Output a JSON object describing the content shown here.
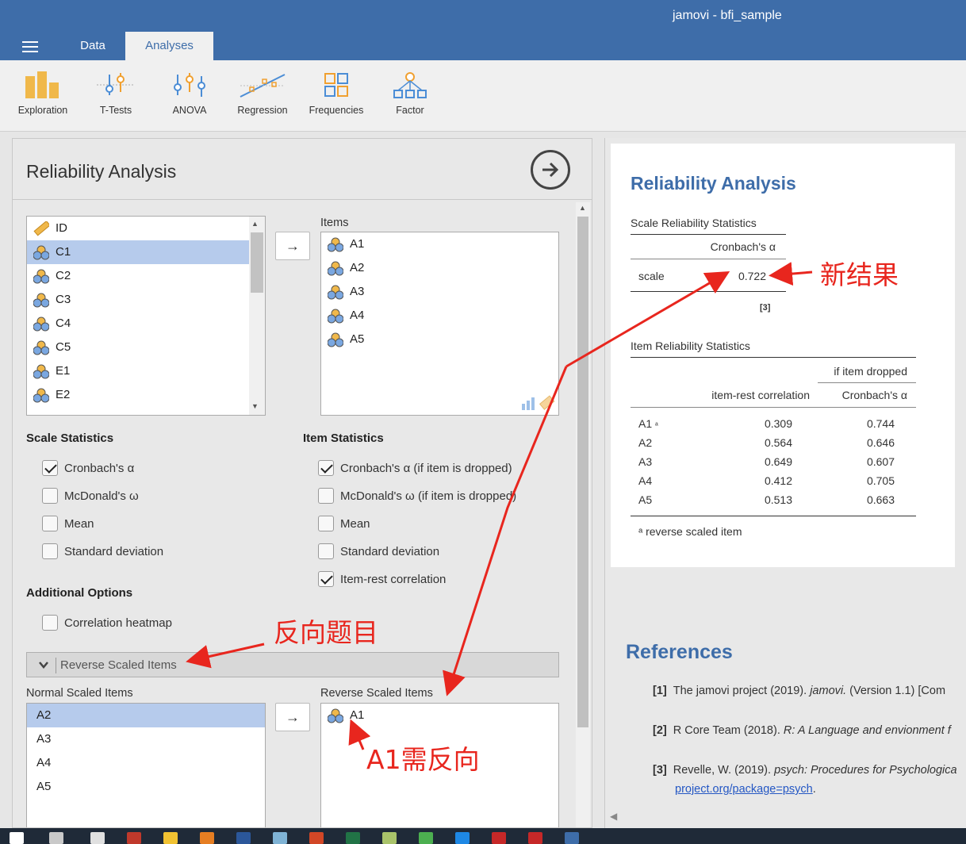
{
  "window": {
    "title": "jamovi - bfi_sample"
  },
  "tabs": [
    {
      "label": "Data"
    },
    {
      "label": "Analyses"
    }
  ],
  "ribbon": [
    {
      "label": "Exploration",
      "icon": "exploration-icon"
    },
    {
      "label": "T-Tests",
      "icon": "t-tests-icon"
    },
    {
      "label": "ANOVA",
      "icon": "anova-icon"
    },
    {
      "label": "Regression",
      "icon": "regression-icon"
    },
    {
      "label": "Frequencies",
      "icon": "frequencies-icon"
    },
    {
      "label": "Factor",
      "icon": "factor-icon"
    }
  ],
  "options": {
    "title": "Reliability Analysis",
    "variables": [
      "ID",
      "C1",
      "C2",
      "C3",
      "C4",
      "C5",
      "E1",
      "E2"
    ],
    "items_label": "Items",
    "items": [
      "A1",
      "A2",
      "A3",
      "A4",
      "A5"
    ],
    "scale_statistics": {
      "heading": "Scale Statistics",
      "options": [
        {
          "label": "Cronbach's α",
          "checked": true
        },
        {
          "label": "McDonald's ω",
          "checked": false
        },
        {
          "label": "Mean",
          "checked": false
        },
        {
          "label": "Standard deviation",
          "checked": false
        }
      ]
    },
    "item_statistics": {
      "heading": "Item Statistics",
      "options": [
        {
          "label": "Cronbach's α (if item is dropped)",
          "checked": true
        },
        {
          "label": "McDonald's ω (if item is dropped)",
          "checked": false
        },
        {
          "label": "Mean",
          "checked": false
        },
        {
          "label": "Standard deviation",
          "checked": false
        },
        {
          "label": "Item-rest correlation",
          "checked": true
        }
      ]
    },
    "additional": {
      "heading": "Additional Options",
      "options": [
        {
          "label": "Correlation heatmap",
          "checked": false
        }
      ]
    },
    "reverse_section": "Reverse Scaled Items",
    "normal_scaled_label": "Normal Scaled Items",
    "normal_scaled": [
      "A2",
      "A3",
      "A4",
      "A5"
    ],
    "reverse_scaled_label": "Reverse Scaled Items",
    "reverse_scaled": [
      "A1"
    ],
    "arrow": "→"
  },
  "results": {
    "title": "Reliability Analysis",
    "scale_table": {
      "caption": "Scale Reliability Statistics",
      "header": "Cronbach's α",
      "row_label": "scale",
      "value": "0.722",
      "footnote_ref": "[3]"
    },
    "item_table": {
      "caption": "Item Reliability Statistics",
      "group_header": "if item dropped",
      "col1": "item-rest correlation",
      "col2": "Cronbach's α",
      "rows": [
        {
          "item": "A1",
          "sup": "ᵃ",
          "irc": "0.309",
          "alpha": "0.744"
        },
        {
          "item": "A2",
          "sup": "",
          "irc": "0.564",
          "alpha": "0.646"
        },
        {
          "item": "A3",
          "sup": "",
          "irc": "0.649",
          "alpha": "0.607"
        },
        {
          "item": "A4",
          "sup": "",
          "irc": "0.412",
          "alpha": "0.705"
        },
        {
          "item": "A5",
          "sup": "",
          "irc": "0.513",
          "alpha": "0.663"
        }
      ],
      "note": "ᵃ reverse scaled item"
    },
    "references": {
      "title": "References",
      "items": [
        {
          "num": "[1]",
          "text": "The jamovi project (2019).",
          "ital": "jamovi.",
          "rest": "(Version 1.1) [Com"
        },
        {
          "num": "[2]",
          "text": "R Core Team (2018).",
          "ital": "R: A Language and envionment f",
          "rest": ""
        },
        {
          "num": "[3]",
          "text": "Revelle, W. (2019).",
          "ital": "psych: Procedures for Psychologica",
          "rest": "",
          "link": "project.org/package=psych",
          "link_tail": "."
        }
      ]
    }
  },
  "annotations": {
    "new_result": "新结果",
    "reverse_items": "反向题目",
    "a1_reverse": "A1需反向"
  },
  "colors": {
    "header": "#3e6da9",
    "selected": "#b6cbec",
    "annotation": "#e8261e"
  }
}
